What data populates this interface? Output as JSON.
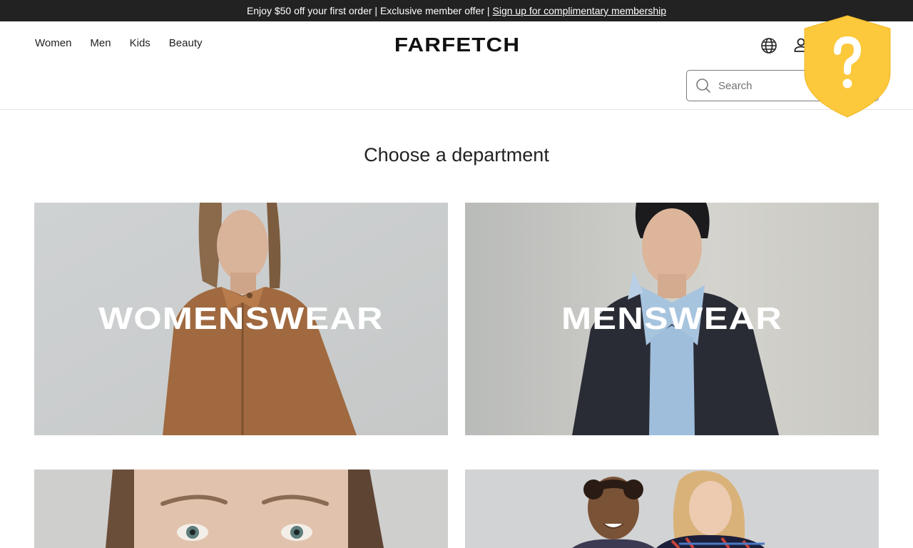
{
  "promo": {
    "text": "Enjoy $50 off your first order | Exclusive member offer |",
    "link": "Sign up for complimentary membership"
  },
  "nav": {
    "items": [
      "Women",
      "Men",
      "Kids",
      "Beauty"
    ]
  },
  "logo": "FARFETCH",
  "search": {
    "placeholder": "Search"
  },
  "main": {
    "heading": "Choose a department",
    "departments": [
      {
        "label": "WOMENSWEAR"
      },
      {
        "label": "MENSWEAR"
      },
      {
        "label": ""
      },
      {
        "label": ""
      }
    ]
  },
  "icons": {
    "globe": "globe-icon",
    "account": "user-icon",
    "search": "search-icon",
    "help": "shield-question-icon"
  },
  "colors": {
    "promo_bg": "#222222",
    "shield": "#fcc83c",
    "text": "#222222"
  }
}
